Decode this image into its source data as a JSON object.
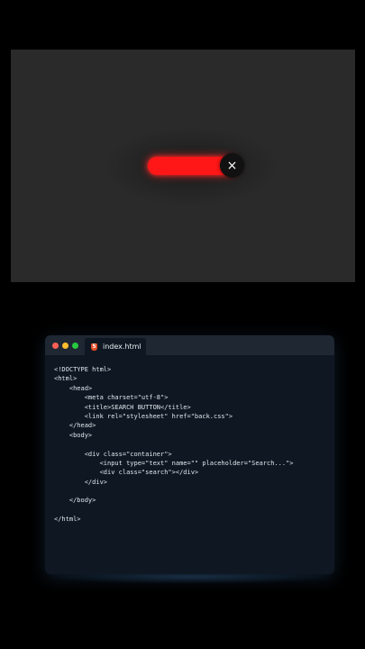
{
  "preview": {
    "search_placeholder": "",
    "search_value": "",
    "close_glyph": "×",
    "input_color": "#ff1616"
  },
  "editor": {
    "tab_label": "index.html",
    "html_badge": "5",
    "lines": [
      "<!DOCTYPE html>",
      "<html>",
      "    <head>",
      "        <meta charset=\"utf-8\">",
      "        <title>SEARCH BUTTON</title>",
      "        <link rel=\"stylesheet\" href=\"back.css\">",
      "    </head>",
      "    <body>",
      "",
      "        <div class=\"container\">",
      "            <input type=\"text\" name=\"\" placeholder=\"Search...\">",
      "            <div class=\"search\"></div>",
      "        </div>",
      "",
      "    </body>",
      "",
      "</html>"
    ]
  }
}
